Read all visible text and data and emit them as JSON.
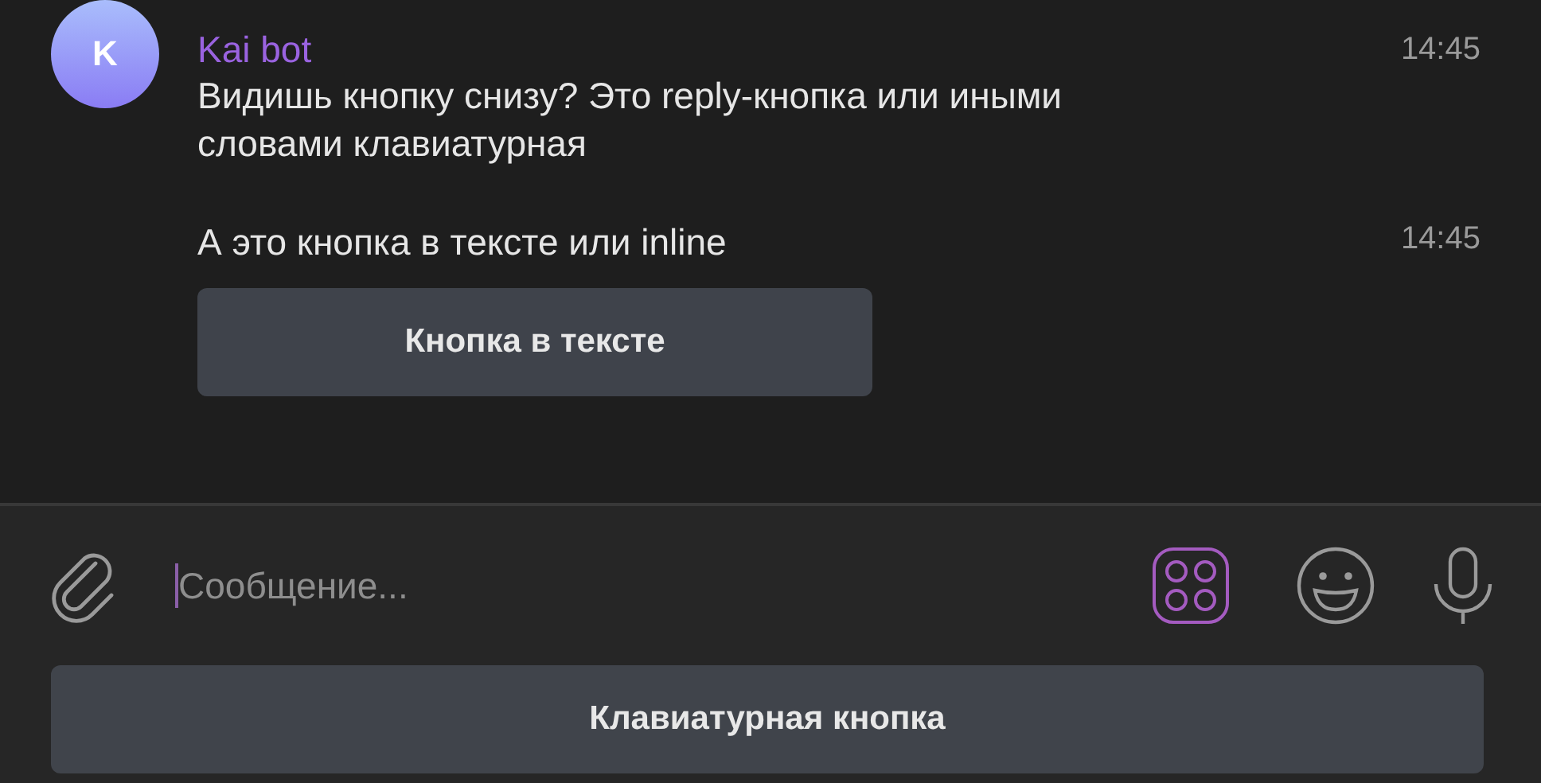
{
  "messages": [
    {
      "sender": "Kai bot",
      "avatar_letter": "K",
      "text": "Видишь кнопку снизу? Это reply-кнопка или иными словами клавиатурная",
      "time": "14:45"
    },
    {
      "text": "А это кнопка в тексте или inline",
      "time": "14:45",
      "inline_buttons": [
        "Кнопка в тексте"
      ]
    }
  ],
  "composer": {
    "placeholder": "Сообщение...",
    "keyboard_shown": true
  },
  "reply_keyboard": [
    "Клавиатурная кнопка"
  ]
}
